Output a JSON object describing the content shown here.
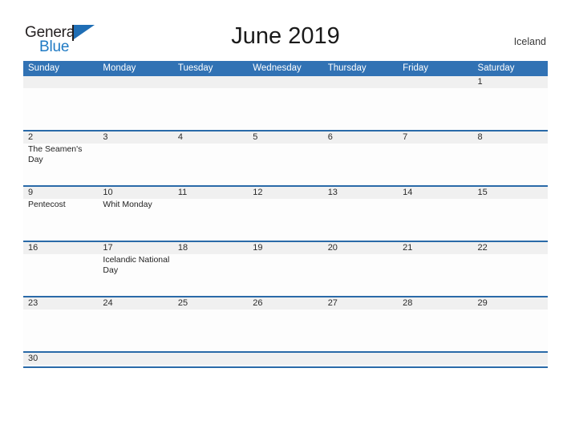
{
  "brand": {
    "name_top": "General",
    "name_bottom": "Blue",
    "flag_color": "#1f6eb5",
    "text_color": "#231f20",
    "accent_color": "#1f7ac4"
  },
  "header": {
    "title": "June 2019",
    "locale": "Iceland"
  },
  "theme": {
    "header_blue": "#3172b4",
    "rule_blue": "#2a6aa8",
    "date_band_gray": "#f0f0f0",
    "cell_white": "#fdfdfd"
  },
  "calendar": {
    "month": "June",
    "year": "2019",
    "weekday_headers": [
      "Sunday",
      "Monday",
      "Tuesday",
      "Wednesday",
      "Thursday",
      "Friday",
      "Saturday"
    ],
    "weeks": [
      {
        "days": [
          {
            "num": "",
            "events": []
          },
          {
            "num": "",
            "events": []
          },
          {
            "num": "",
            "events": []
          },
          {
            "num": "",
            "events": []
          },
          {
            "num": "",
            "events": []
          },
          {
            "num": "",
            "events": []
          },
          {
            "num": "1",
            "events": []
          }
        ]
      },
      {
        "days": [
          {
            "num": "2",
            "events": [
              "The Seamen's Day"
            ]
          },
          {
            "num": "3",
            "events": []
          },
          {
            "num": "4",
            "events": []
          },
          {
            "num": "5",
            "events": []
          },
          {
            "num": "6",
            "events": []
          },
          {
            "num": "7",
            "events": []
          },
          {
            "num": "8",
            "events": []
          }
        ]
      },
      {
        "days": [
          {
            "num": "9",
            "events": [
              "Pentecost"
            ]
          },
          {
            "num": "10",
            "events": [
              "Whit Monday"
            ]
          },
          {
            "num": "11",
            "events": []
          },
          {
            "num": "12",
            "events": []
          },
          {
            "num": "13",
            "events": []
          },
          {
            "num": "14",
            "events": []
          },
          {
            "num": "15",
            "events": []
          }
        ]
      },
      {
        "days": [
          {
            "num": "16",
            "events": []
          },
          {
            "num": "17",
            "events": [
              "Icelandic National Day"
            ]
          },
          {
            "num": "18",
            "events": []
          },
          {
            "num": "19",
            "events": []
          },
          {
            "num": "20",
            "events": []
          },
          {
            "num": "21",
            "events": []
          },
          {
            "num": "22",
            "events": []
          }
        ]
      },
      {
        "days": [
          {
            "num": "23",
            "events": []
          },
          {
            "num": "24",
            "events": []
          },
          {
            "num": "25",
            "events": []
          },
          {
            "num": "26",
            "events": []
          },
          {
            "num": "27",
            "events": []
          },
          {
            "num": "28",
            "events": []
          },
          {
            "num": "29",
            "events": []
          }
        ]
      },
      {
        "days": [
          {
            "num": "30",
            "events": []
          },
          {
            "num": "",
            "events": []
          },
          {
            "num": "",
            "events": []
          },
          {
            "num": "",
            "events": []
          },
          {
            "num": "",
            "events": []
          },
          {
            "num": "",
            "events": []
          },
          {
            "num": "",
            "events": []
          }
        ]
      }
    ]
  }
}
